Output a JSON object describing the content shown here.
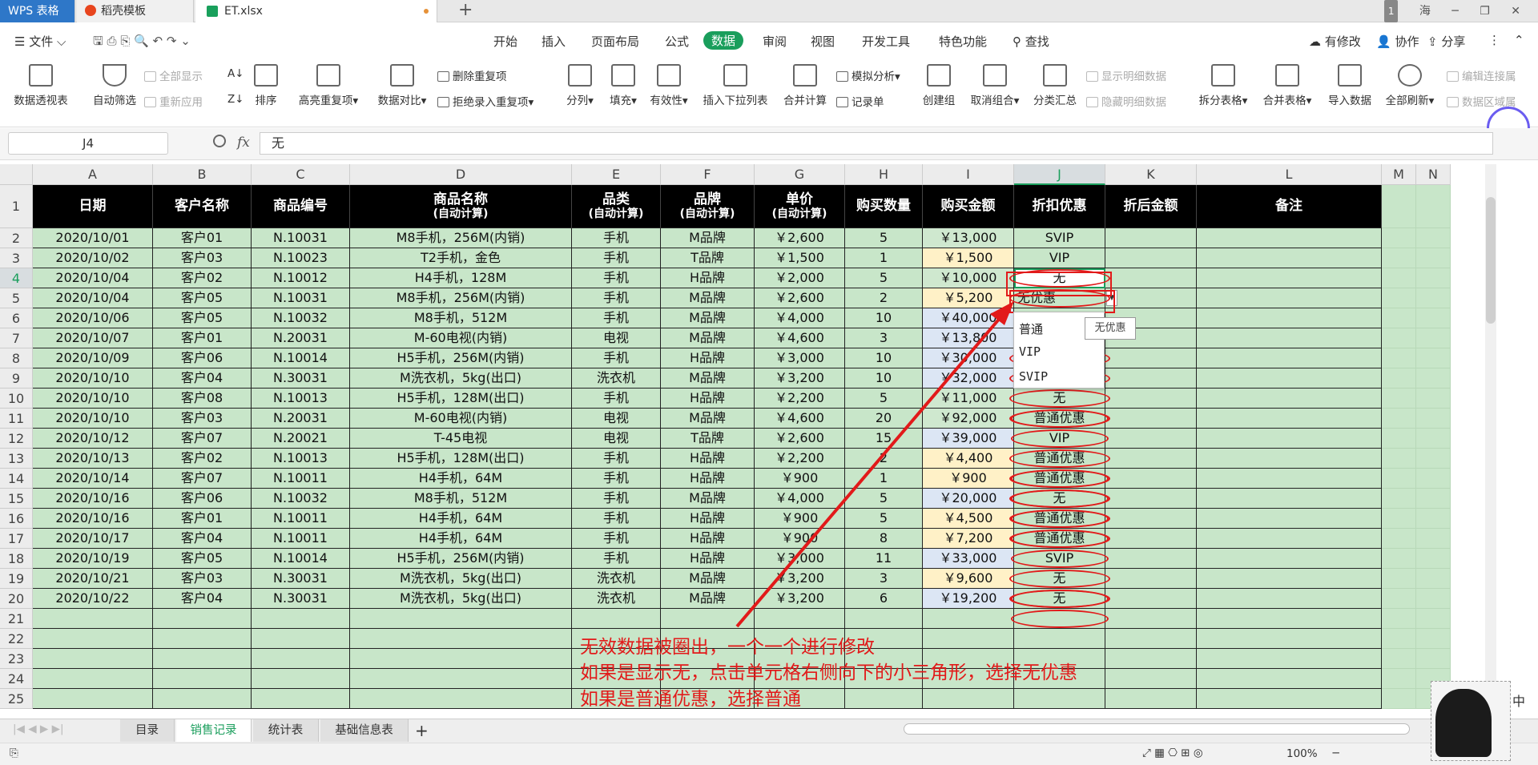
{
  "window": {
    "app_tab": "WPS 表格",
    "template_tab": "稻壳模板",
    "file_tab": "ET.xlsx",
    "badge": "1",
    "user": "海"
  },
  "menu": {
    "file": "文件",
    "tabs": [
      "开始",
      "插入",
      "页面布局",
      "公式",
      "数据",
      "审阅",
      "视图",
      "开发工具",
      "特色功能"
    ],
    "active": "数据",
    "search": "查找",
    "right": [
      "有修改",
      "协作",
      "分享"
    ]
  },
  "ribbon": {
    "pivot": "数据透视表",
    "autofilter": "自动筛选",
    "show_all": "全部显示",
    "reapply": "重新应用",
    "sort": "排序",
    "highlight_dup": "高亮重复项",
    "compare": "数据对比",
    "remove_dup": "删除重复项",
    "reject_dup": "拒绝录入重复项",
    "split": "分列",
    "fill": "填充",
    "validity": "有效性",
    "dropdown": "插入下拉列表",
    "consolidate": "合并计算",
    "simulate": "模拟分析",
    "record": "记录单",
    "group": "创建组",
    "ungroup": "取消组合",
    "subtotal": "分类汇总",
    "show_detail": "显示明细数据",
    "hide_detail": "隐藏明细数据",
    "split_table": "拆分表格",
    "merge_table": "合并表格",
    "import": "导入数据",
    "refresh_all": "全部刷新",
    "edit_links": "编辑连接属",
    "data_area": "数据区域属"
  },
  "formula": {
    "cell_ref": "J4",
    "fx": "fx",
    "value": "无"
  },
  "columns": [
    "A",
    "B",
    "C",
    "D",
    "E",
    "F",
    "G",
    "H",
    "I",
    "J",
    "K",
    "L",
    "M",
    "N"
  ],
  "rows_nums": [
    "1",
    "2",
    "3",
    "4",
    "5",
    "6",
    "7",
    "8",
    "9",
    "10",
    "11",
    "12",
    "13",
    "14",
    "15",
    "16",
    "17",
    "18",
    "19",
    "20",
    "21",
    "22",
    "23",
    "24",
    "25"
  ],
  "headers": [
    {
      "main": "日期",
      "sub": ""
    },
    {
      "main": "客户名称",
      "sub": ""
    },
    {
      "main": "商品编号",
      "sub": ""
    },
    {
      "main": "商品名称",
      "sub": "(自动计算)"
    },
    {
      "main": "品类",
      "sub": "(自动计算)"
    },
    {
      "main": "品牌",
      "sub": "(自动计算)"
    },
    {
      "main": "单价",
      "sub": "(自动计算)"
    },
    {
      "main": "购买数量",
      "sub": ""
    },
    {
      "main": "购买金额",
      "sub": ""
    },
    {
      "main": "折扣优惠",
      "sub": ""
    },
    {
      "main": "折后金额",
      "sub": ""
    },
    {
      "main": "备注",
      "sub": ""
    }
  ],
  "rows": [
    [
      "2020/10/01",
      "客户01",
      "N.10031",
      "M8手机，256M(内销)",
      "手机",
      "M品牌",
      "￥2,600",
      "5",
      "￥13,000",
      "SVIP"
    ],
    [
      "2020/10/02",
      "客户03",
      "N.10023",
      "T2手机，金色",
      "手机",
      "T品牌",
      "￥1,500",
      "1",
      "￥1,500",
      "VIP"
    ],
    [
      "2020/10/04",
      "客户02",
      "N.10012",
      "H4手机，128M",
      "手机",
      "H品牌",
      "￥2,000",
      "5",
      "￥10,000",
      "无"
    ],
    [
      "2020/10/04",
      "客户05",
      "N.10031",
      "M8手机，256M(内销)",
      "手机",
      "M品牌",
      "￥2,600",
      "2",
      "￥5,200",
      "无优惠"
    ],
    [
      "2020/10/06",
      "客户05",
      "N.10032",
      "M8手机，512M",
      "手机",
      "M品牌",
      "￥4,000",
      "10",
      "￥40,000",
      ""
    ],
    [
      "2020/10/07",
      "客户01",
      "N.20031",
      "M-60电视(内销)",
      "电视",
      "M品牌",
      "￥4,600",
      "3",
      "￥13,800",
      ""
    ],
    [
      "2020/10/09",
      "客户06",
      "N.10014",
      "H5手机，256M(内销)",
      "手机",
      "H品牌",
      "￥3,000",
      "10",
      "￥30,000",
      ""
    ],
    [
      "2020/10/10",
      "客户04",
      "N.30031",
      "M洗衣机，5kg(出口)",
      "洗衣机",
      "M品牌",
      "￥3,200",
      "10",
      "￥32,000",
      ""
    ],
    [
      "2020/10/10",
      "客户08",
      "N.10013",
      "H5手机，128M(出口)",
      "手机",
      "H品牌",
      "￥2,200",
      "5",
      "￥11,000",
      "无"
    ],
    [
      "2020/10/10",
      "客户03",
      "N.20031",
      "M-60电视(内销)",
      "电视",
      "M品牌",
      "￥4,600",
      "20",
      "￥92,000",
      "普通优惠"
    ],
    [
      "2020/10/12",
      "客户07",
      "N.20021",
      "T-45电视",
      "电视",
      "T品牌",
      "￥2,600",
      "15",
      "￥39,000",
      "VIP"
    ],
    [
      "2020/10/13",
      "客户02",
      "N.10013",
      "H5手机，128M(出口)",
      "手机",
      "H品牌",
      "￥2,200",
      "2",
      "￥4,400",
      "普通优惠"
    ],
    [
      "2020/10/14",
      "客户07",
      "N.10011",
      "H4手机，64M",
      "手机",
      "H品牌",
      "￥900",
      "1",
      "￥900",
      "普通优惠"
    ],
    [
      "2020/10/16",
      "客户06",
      "N.10032",
      "M8手机，512M",
      "手机",
      "M品牌",
      "￥4,000",
      "5",
      "￥20,000",
      "无"
    ],
    [
      "2020/10/16",
      "客户01",
      "N.10011",
      "H4手机，64M",
      "手机",
      "H品牌",
      "￥900",
      "5",
      "￥4,500",
      "普通优惠"
    ],
    [
      "2020/10/17",
      "客户04",
      "N.10011",
      "H4手机，64M",
      "手机",
      "H品牌",
      "￥900",
      "8",
      "￥7,200",
      "普通优惠"
    ],
    [
      "2020/10/19",
      "客户05",
      "N.10014",
      "H5手机，256M(内销)",
      "手机",
      "H品牌",
      "￥3,000",
      "11",
      "￥33,000",
      "SVIP"
    ],
    [
      "2020/10/21",
      "客户03",
      "N.30031",
      "M洗衣机，5kg(出口)",
      "洗衣机",
      "M品牌",
      "￥3,200",
      "3",
      "￥9,600",
      "无"
    ],
    [
      "2020/10/22",
      "客户04",
      "N.30031",
      "M洗衣机，5kg(出口)",
      "洗衣机",
      "M品牌",
      "￥3,200",
      "6",
      "￥19,200",
      "无"
    ]
  ],
  "amount_colors": [
    "#cfe8cf",
    "#fff1c7",
    "#cfe8cf",
    "#fff1c7",
    "#dce6f4",
    "#dce6f4",
    "#dce6f4",
    "#dce6f4",
    "#cfe8cf",
    "#cfe8cf",
    "#dce6f4",
    "#fff1c7",
    "#fff1c7",
    "#dce6f4",
    "#fff1c7",
    "#fff1c7",
    "#dce6f4",
    "#fff1c7",
    "#dce6f4"
  ],
  "dropdown": {
    "options": [
      "普通",
      "VIP",
      "SVIP"
    ],
    "tooltip": "无优惠"
  },
  "annotation": [
    "无效数据被圈出，一个一个进行修改",
    "如果是显示无，点击单元格右侧向下的小三角形，选择无优惠",
    "如果是普通优惠，选择普通"
  ],
  "sheets": [
    "目录",
    "销售记录",
    "统计表",
    "基础信息表"
  ],
  "active_sheet": "销售记录",
  "status": {
    "zoom": "100%",
    "ime": "中"
  },
  "colors": {
    "accent": "#1a9e5c",
    "cell_bg": "#c8e6c9",
    "header_bg": "#000000",
    "annot": "#e21a1a"
  }
}
